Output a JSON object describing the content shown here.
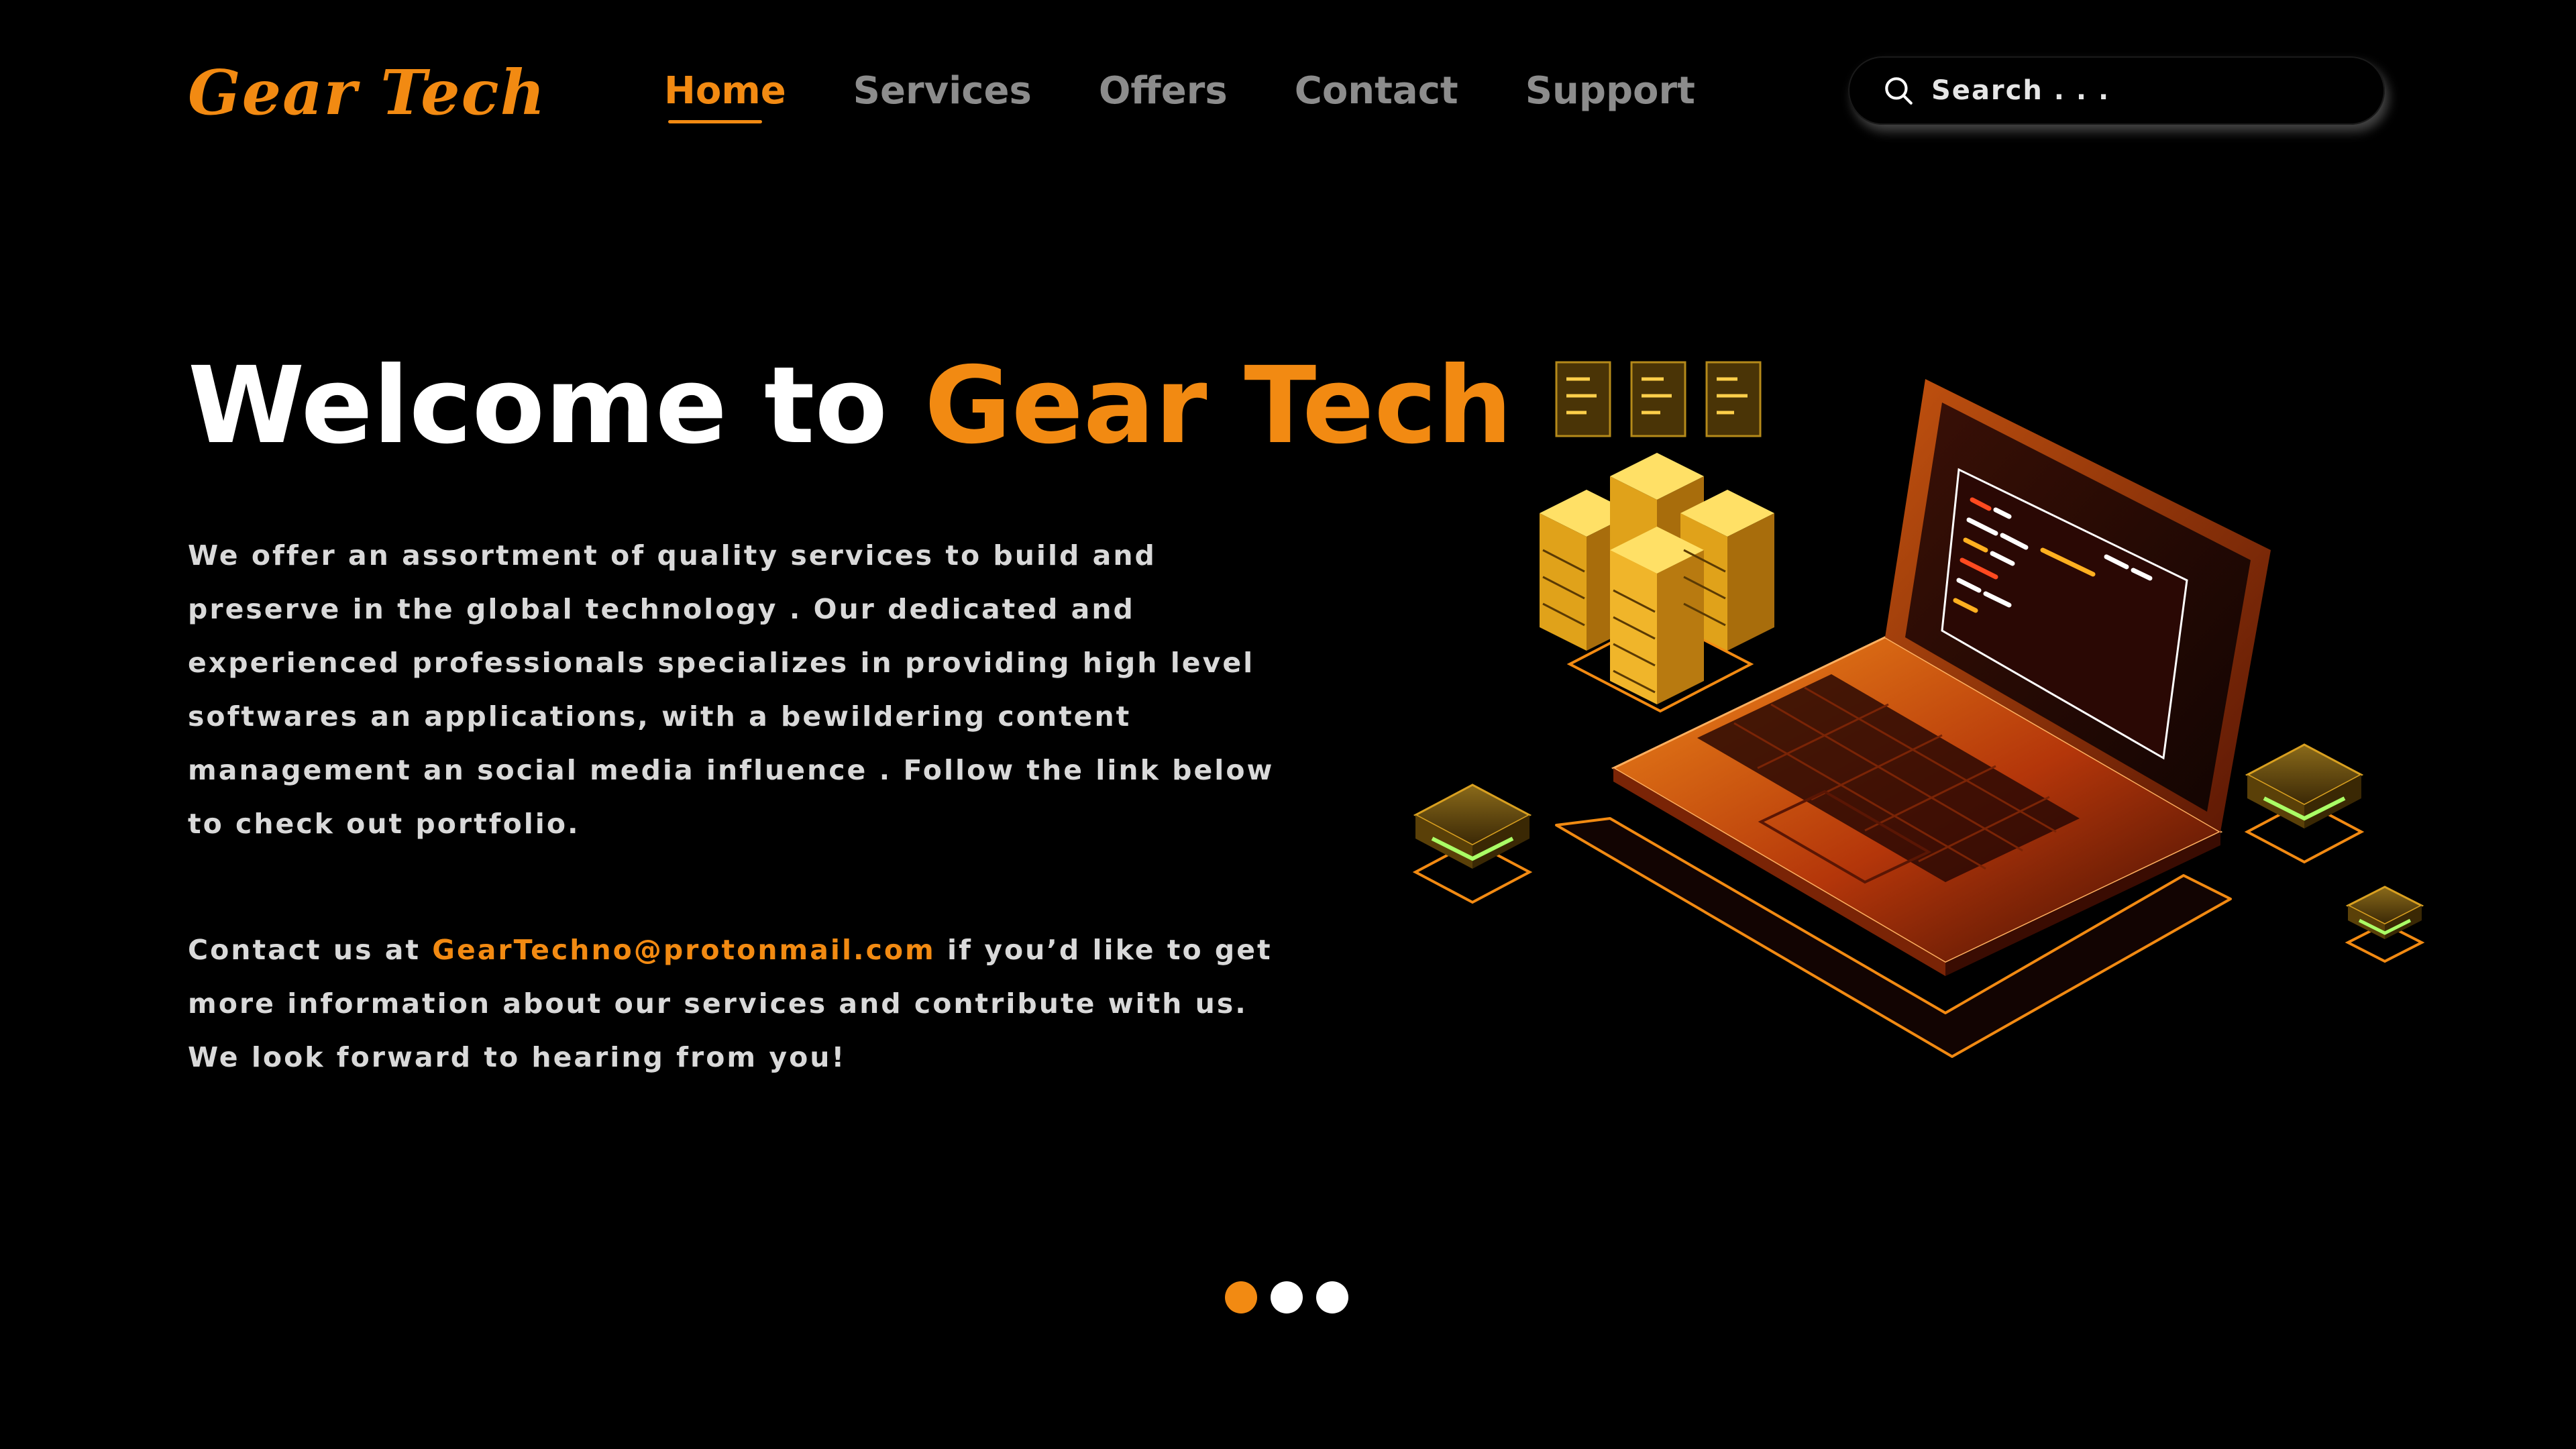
{
  "brand": {
    "logo": "Gear Tech"
  },
  "nav": {
    "items": [
      {
        "label": "Home",
        "active": true
      },
      {
        "label": "Services",
        "active": false
      },
      {
        "label": "Offers",
        "active": false
      },
      {
        "label": "Contact",
        "active": false
      },
      {
        "label": "Support",
        "active": false
      }
    ]
  },
  "search": {
    "placeholder": "Search . . .",
    "value": "",
    "icon": "search-icon"
  },
  "hero": {
    "title_prefix": "Welcome to ",
    "title_accent": "Gear Tech",
    "description": "We offer an assortment of quality services to build and preserve in the global technology . Our dedicated and experienced professionals specializes in providing high level softwares an applications, with a bewildering content management an social media influence . Follow the link below to check out portfolio.",
    "contact_prefix": "Contact us at ",
    "contact_email": "GearTechno@protonmail.com",
    "contact_suffix": " if you’d like to get more information about our services and contribute with us. We look forward to hearing from you!"
  },
  "illustration": {
    "description_icon": "laptop-servers-illustration"
  },
  "pagination": {
    "total": 3,
    "active_index": 0
  },
  "colors": {
    "accent": "#f28a12",
    "background": "#000000",
    "nav_inactive": "#8c8c8c",
    "body_text": "#d9d9d9",
    "dot_inactive": "#ffffff"
  }
}
